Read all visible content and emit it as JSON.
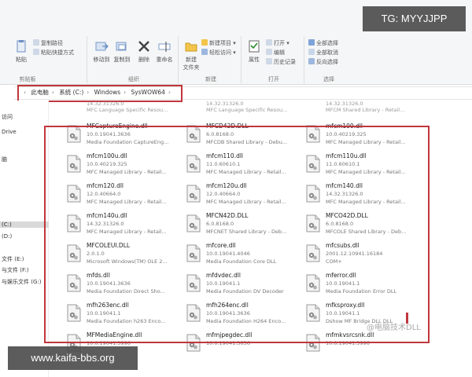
{
  "watermarks": {
    "top_right": "TG: MYYJJPP",
    "bottom_left": "www.kaifa-bbs.org",
    "bottom_zh": "@电脑技术DLL"
  },
  "ribbon": {
    "clipboard": {
      "group_label": "剪贴板",
      "pin_label": "粘贴",
      "copy_path": "复制路径",
      "paste_shortcut": "粘贴快捷方式"
    },
    "organize": {
      "group_label": "组织",
      "move_to": "移动到",
      "copy_to": "复制到",
      "delete": "删除",
      "rename": "重命名"
    },
    "new": {
      "group_label": "新建",
      "new_folder_line1": "新建",
      "new_folder_line2": "文件夹",
      "new_item": "新建项目 ▾",
      "easy_access": "轻松访问 ▾"
    },
    "open": {
      "group_label": "打开",
      "properties": "属性",
      "open": "打开 ▾",
      "edit": "编辑",
      "history": "历史记录"
    },
    "select": {
      "group_label": "选择",
      "select_all": "全部选择",
      "select_none": "全部取消",
      "invert": "反向选择"
    }
  },
  "address": {
    "crumbs": [
      "此电脑",
      "系统 (C:)",
      "Windows",
      "SysWOW64"
    ]
  },
  "nav": {
    "items": [
      "访问",
      "Drive",
      "脑",
      "(C:)",
      "(D:)",
      "文件 (E:)",
      "与文件 (F:)",
      "与娱乐文件 (G:)"
    ]
  },
  "top_row": [
    {
      "ver": "14.32.31326.0",
      "desc": "MFC Language Specific Resou..."
    },
    {
      "ver": "14.32.31326.0",
      "desc": "MFC Language Specific Resou..."
    },
    {
      "ver": "14.32.31326.0",
      "desc": "MFCM Shared Library - Retail..."
    }
  ],
  "files": [
    {
      "name": "MFCaptureEngine.dll",
      "ver": "10.0.19041.3636",
      "desc": "Media Foundation CaptureEng..."
    },
    {
      "name": "MFCD42D.DLL",
      "ver": "6.0.8168.0",
      "desc": "MFCDB Shared Library - Debu..."
    },
    {
      "name": "mfcm100.dll",
      "ver": "10.0.40219.325",
      "desc": "MFC Managed Library - Retail..."
    },
    {
      "name": "mfcm100u.dll",
      "ver": "10.0.40219.325",
      "desc": "MFC Managed Library - Retail..."
    },
    {
      "name": "mfcm110.dll",
      "ver": "11.0.60610.1",
      "desc": "MFC Managed Library - Retail..."
    },
    {
      "name": "mfcm110u.dll",
      "ver": "11.0.60610.1",
      "desc": "MFC Managed Library - Retail..."
    },
    {
      "name": "mfcm120.dll",
      "ver": "12.0.40664.0",
      "desc": "MFC Managed Library - Retail..."
    },
    {
      "name": "mfcm120u.dll",
      "ver": "12.0.40664.0",
      "desc": "MFC Managed Library - Retail..."
    },
    {
      "name": "mfcm140.dll",
      "ver": "14.32.31326.0",
      "desc": "MFC Managed Library - Retail..."
    },
    {
      "name": "mfcm140u.dll",
      "ver": "14.32.31326.0",
      "desc": "MFC Managed Library - Retail..."
    },
    {
      "name": "MFCN42D.DLL",
      "ver": "6.0.8168.0",
      "desc": "MFCNET Shared Library - Deb..."
    },
    {
      "name": "MFCO42D.DLL",
      "ver": "6.0.8168.0",
      "desc": "MFCOLE Shared Library - Deb..."
    },
    {
      "name": "MFCOLEUI.DLL",
      "ver": "2.0.1.0",
      "desc": "Microsoft Windows(TM) OLE 2..."
    },
    {
      "name": "mfcore.dll",
      "ver": "10.0.19041.4046",
      "desc": "Media Foundation Core DLL"
    },
    {
      "name": "mfcsubs.dll",
      "ver": "2001.12.10941.16184",
      "desc": "COM+"
    },
    {
      "name": "mfds.dll",
      "ver": "10.0.19041.3636",
      "desc": "Media Foundation Direct Sho..."
    },
    {
      "name": "mfdvdec.dll",
      "ver": "10.0.19041.1",
      "desc": "Media Foundation DV Decoder"
    },
    {
      "name": "mferror.dll",
      "ver": "10.0.19041.1",
      "desc": "Media Foundation Error DLL"
    },
    {
      "name": "mfh263enc.dll",
      "ver": "10.0.19041.1",
      "desc": "Media Foundation h263 Enco..."
    },
    {
      "name": "mfh264enc.dll",
      "ver": "10.0.19041.3636",
      "desc": "Media Foundation H264 Enco..."
    },
    {
      "name": "mfksproxy.dll",
      "ver": "10.0.19041.1",
      "desc": "Dshow MF Bridge DLL DLL"
    },
    {
      "name": "MFMediaEngine.dll",
      "ver": "10.0.19041.3996",
      "desc": ""
    },
    {
      "name": "mfmjpegdec.dll",
      "ver": "10.0.19041.3636",
      "desc": ""
    },
    {
      "name": "mfmkvsrcsnk.dll",
      "ver": "10.0.19041.3996",
      "desc": ""
    }
  ],
  "colors": {
    "highlight": "#c0373d",
    "ribbon_bg": "#f5f6f7"
  }
}
